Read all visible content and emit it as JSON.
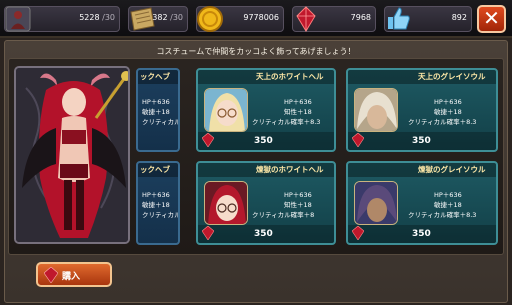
{
  "resources": {
    "stamina": {
      "value": "5228",
      "cap": "/30",
      "icon": "character-silhouette-icon"
    },
    "scroll": {
      "value": "382",
      "cap": "/30",
      "icon": "scroll-map-icon"
    },
    "gold": {
      "value": "9778006",
      "icon": "gold-coin-icon"
    },
    "gems": {
      "value": "7968",
      "icon": "red-gem-icon"
    },
    "likes": {
      "value": "892",
      "icon": "thumbs-up-icon"
    }
  },
  "close_label": "✕",
  "instruction": "コスチュームで仲間をカッコよく飾ってあげましょう！",
  "cards": [
    {
      "name": "ックヘブ",
      "stats": [
        "HP＋636",
        "敏捷＋18",
        "クリティカル"
      ],
      "price": "350",
      "partial": true
    },
    {
      "name": "天上のホワイトヘル",
      "stats": [
        "HP＋636",
        "知性＋18",
        "クリティカル確率＋8.3"
      ],
      "price": "350"
    },
    {
      "name": "天上のグレイソウル",
      "stats": [
        "HP＋636",
        "敏捷＋18",
        "クリティカル確率＋8.3"
      ],
      "price": "350"
    },
    {
      "name": "ックヘブ",
      "stats": [
        "HP＋636",
        "敏捷＋18",
        "クリティカル"
      ],
      "price": "350",
      "partial": true
    },
    {
      "name": "煉獄のホワイトヘル",
      "stats": [
        "HP＋636",
        "知性＋18",
        "クリティカル確率＋8"
      ],
      "price": "350"
    },
    {
      "name": "煉獄のグレイソウル",
      "stats": [
        "HP＋636",
        "敏捷＋18",
        "クリティカル確率＋8.3"
      ],
      "price": "350"
    }
  ],
  "buy_label": "購入",
  "colors": {
    "accent": "#e06a2e",
    "card_teal": "#1e5a63",
    "gem_red": "#c0182c"
  }
}
